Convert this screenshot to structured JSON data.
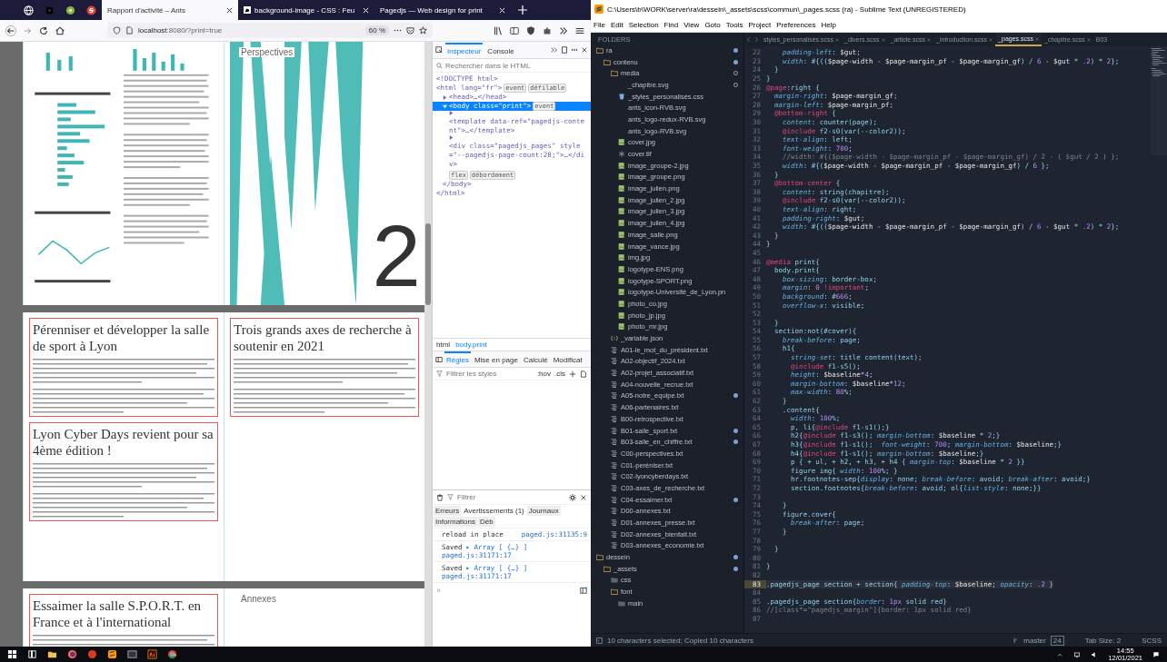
{
  "browser": {
    "tabs": [
      {
        "kind": "globe",
        "selected": false
      },
      {
        "kind": "dark",
        "selected": false
      },
      {
        "kind": "green",
        "selected": false
      },
      {
        "kind": "red",
        "selected": false
      },
      {
        "kind": "page",
        "title": "Rapport d'activité – Ants",
        "selected": true
      },
      {
        "kind": "mdn",
        "title": "background-image - CSS : Feu",
        "selected": false
      },
      {
        "kind": "page",
        "title": "Pagedjs — Web design for print",
        "selected": false
      }
    ],
    "url_host": "localhost",
    "url_rest": ":8080/?print=true",
    "zoom": "60 %",
    "document": {
      "spreads": [
        {
          "pages": [
            {
              "kind": "charts"
            },
            {
              "kind": "chapter",
              "label": "Perspectives",
              "number": "2"
            }
          ]
        },
        {
          "pages": [
            {
              "kind": "article",
              "headings": [
                "Pérenniser et développer la salle de sport à Lyon",
                "Lyon Cyber Days revient pour sa 4ème édition !"
              ]
            },
            {
              "kind": "article",
              "headings": [
                "Trois grands axes de recherche à soutenir en 2021"
              ]
            }
          ]
        },
        {
          "pages": [
            {
              "kind": "article",
              "headings": [
                "Essaimer la salle S.P.O.R.T. en France et à l'international"
              ]
            },
            {
              "kind": "label",
              "label": "Annexes"
            }
          ]
        }
      ]
    },
    "devtools": {
      "tabs": [
        {
          "label": "Inspecteur",
          "selected": true
        },
        {
          "label": "Console",
          "selected": false
        }
      ],
      "search_placeholder": "Rechercher dans le HTML",
      "tree": [
        {
          "text": "<!DOCTYPE html>",
          "selected": false
        },
        {
          "text": "<html lang=\"fr\">",
          "badges": [
            "event",
            "défilable"
          ],
          "selected": false,
          "children": [
            {
              "text": "<head>…</head>",
              "expanded": false,
              "selected": false
            },
            {
              "text": "<body class=\"print\">",
              "badges": [
                "event"
              ],
              "expanded": true,
              "selected": true,
              "children": [
                {
                  "text": "<template data-ref=\"pagedjs-content\">…</template>",
                  "expanded": false,
                  "selected": false
                },
                {
                  "text": "<div class=\"pagedjs_pages\" style=\"--pagedjs-page-count:28;\">…</div>",
                  "badges": [
                    "flex",
                    "débordement"
                  ],
                  "expanded": false,
                  "selected": false
                }
              ]
            },
            {
              "text": "</body>",
              "selected": false
            }
          ]
        },
        {
          "text": "</html>",
          "selected": false
        }
      ],
      "breadcrumb": [
        "html",
        "body.print"
      ],
      "rules_tabs": [
        {
          "label": "Règles",
          "selected": true
        },
        {
          "label": "Mise en page",
          "selected": false
        },
        {
          "label": "Calculé",
          "selected": false
        },
        {
          "label": "Modificat",
          "selected": false
        }
      ],
      "rules_filter_placeholder": "Filtrer les styles",
      "rules_buttons": [
        ":hov",
        ".cls"
      ],
      "console_filter_placeholder": "Filtrer",
      "console_tabs": [
        {
          "label": "Erreurs",
          "selected": false
        },
        {
          "label": "Avertissements (1)",
          "selected": true
        },
        {
          "label": "Journaux",
          "selected": false
        },
        {
          "label": "Informations",
          "selected": false
        },
        {
          "label": "Déb",
          "selected": false
        }
      ],
      "messages": [
        {
          "text": "reload in place",
          "source": "paged.js:31135:9"
        },
        {
          "text": "Saved",
          "object": "▸ Array [ {…} ]",
          "source": "paged.js:31171:17"
        },
        {
          "text": "Saved",
          "object": "▸ Array [ {…} ]",
          "source": "paged.js:31171:17"
        }
      ],
      "prompt": "»"
    }
  },
  "editor": {
    "title": "C:\\Users\\b\\WORK\\server\\ra\\dessein\\_assets\\scss\\commun\\_pages.scss (ra) - Sublime Text (UNREGISTERED)",
    "menu": [
      "File",
      "Edit",
      "Selection",
      "Find",
      "View",
      "Goto",
      "Tools",
      "Project",
      "Preferences",
      "Help"
    ],
    "sidebar_heading": "FOLDERS",
    "tree": [
      {
        "name": "ra",
        "kind": "folder",
        "expanded": true,
        "modified": true,
        "untracked": false,
        "children": [
          {
            "name": "contenu",
            "kind": "folder",
            "expanded": true,
            "modified": true,
            "untracked": false,
            "children": [
              {
                "name": "media",
                "kind": "folder",
                "expanded": true,
                "modified": false,
                "untracked": true,
                "children": [
                  {
                    "name": "_chapitre.svg",
                    "kind": "svg",
                    "modified": false,
                    "untracked": true
                  },
                  {
                    "name": "_styles_personalisés.css",
                    "kind": "css",
                    "modified": false,
                    "untracked": false
                  },
                  {
                    "name": "ants_icon-RVB.svg",
                    "kind": "svg",
                    "modified": false,
                    "untracked": false
                  },
                  {
                    "name": "ants_logo-redux-RVB.svg",
                    "kind": "svg",
                    "modified": false,
                    "untracked": false
                  },
                  {
                    "name": "ants_logo-RVB.svg",
                    "kind": "svg",
                    "modified": false,
                    "untracked": false
                  },
                  {
                    "name": "cover.jpg",
                    "kind": "image",
                    "modified": false,
                    "untracked": false
                  },
                  {
                    "name": "cover.tif",
                    "kind": "tif",
                    "modified": false,
                    "untracked": false
                  },
                  {
                    "name": "image_groupe-2.jpg",
                    "kind": "image",
                    "modified": false,
                    "untracked": false
                  },
                  {
                    "name": "image_groupe.png",
                    "kind": "image",
                    "modified": false,
                    "untracked": false
                  },
                  {
                    "name": "image_julien.png",
                    "kind": "image",
                    "modified": false,
                    "untracked": false
                  },
                  {
                    "name": "image_julien_2.jpg",
                    "kind": "image",
                    "modified": false,
                    "untracked": false
                  },
                  {
                    "name": "image_julien_3.jpg",
                    "kind": "image",
                    "modified": false,
                    "untracked": false
                  },
                  {
                    "name": "image_julien_4.jpg",
                    "kind": "image",
                    "modified": false,
                    "untracked": false
                  },
                  {
                    "name": "image_salle.png",
                    "kind": "image",
                    "modified": false,
                    "untracked": false
                  },
                  {
                    "name": "image_vance.jpg",
                    "kind": "image",
                    "modified": false,
                    "untracked": false
                  },
                  {
                    "name": "img.jpg",
                    "kind": "image",
                    "modified": false,
                    "untracked": false
                  },
                  {
                    "name": "logotype-ENS.png",
                    "kind": "image",
                    "modified": false,
                    "untracked": false
                  },
                  {
                    "name": "logotype-SPORT.png",
                    "kind": "image",
                    "modified": false,
                    "untracked": false
                  },
                  {
                    "name": "logotype-Université_de_Lyon.pn",
                    "kind": "image",
                    "modified": false,
                    "untracked": false
                  },
                  {
                    "name": "photo_co.jpg",
                    "kind": "image",
                    "modified": false,
                    "untracked": false
                  },
                  {
                    "name": "photo_jp.jpg",
                    "kind": "image",
                    "modified": false,
                    "untracked": false
                  },
                  {
                    "name": "photo_mr.jpg",
                    "kind": "image",
                    "modified": false,
                    "untracked": false
                  }
                ]
              },
              {
                "name": "_variable.json",
                "kind": "json",
                "modified": false,
                "untracked": false
              },
              {
                "name": "A01-le_mot_du_président.txt",
                "kind": "text",
                "modified": false,
                "untracked": false
              },
              {
                "name": "A02-objectif_2024.txt",
                "kind": "text",
                "modified": false,
                "untracked": false
              },
              {
                "name": "A02-projet_associatif.txt",
                "kind": "text",
                "modified": false,
                "untracked": false
              },
              {
                "name": "A04-nouvelle_recrue.txt",
                "kind": "text",
                "modified": false,
                "untracked": false
              },
              {
                "name": "A05-notre_equipe.txt",
                "kind": "text",
                "modified": true,
                "untracked": false
              },
              {
                "name": "A06-partenaires.txt",
                "kind": "text",
                "modified": false,
                "untracked": false
              },
              {
                "name": "B00-retrospective.txt",
                "kind": "text",
                "modified": false,
                "untracked": false
              },
              {
                "name": "B01-salle_sport.txt",
                "kind": "text",
                "modified": true,
                "untracked": false
              },
              {
                "name": "B03-salle_en_chiffre.txt",
                "kind": "text",
                "modified": true,
                "untracked": false
              },
              {
                "name": "C00-perspectives.txt",
                "kind": "text",
                "modified": false,
                "untracked": false
              },
              {
                "name": "C01-peréniser.txt",
                "kind": "text",
                "modified": false,
                "untracked": false
              },
              {
                "name": "C02-lyoncyberdays.txt",
                "kind": "text",
                "modified": false,
                "untracked": false
              },
              {
                "name": "C03-axes_de_recherche.txt",
                "kind": "text",
                "modified": false,
                "untracked": false
              },
              {
                "name": "C04-essaimer.txt",
                "kind": "text",
                "modified": true,
                "untracked": false
              },
              {
                "name": "D00-annexes.txt",
                "kind": "text",
                "modified": false,
                "untracked": false
              },
              {
                "name": "D01-annexes_presse.txt",
                "kind": "text",
                "modified": false,
                "untracked": false
              },
              {
                "name": "D02-annexes_bienfait.txt",
                "kind": "text",
                "modified": false,
                "untracked": false
              },
              {
                "name": "D03-annexes_economie.txt",
                "kind": "text",
                "modified": false,
                "untracked": false
              }
            ]
          }
        ]
      },
      {
        "name": "dessein",
        "kind": "folder",
        "expanded": true,
        "modified": true,
        "untracked": false,
        "children": [
          {
            "name": "_assets",
            "kind": "folder",
            "expanded": true,
            "modified": true,
            "untracked": false,
            "children": [
              {
                "name": "css",
                "kind": "folder",
                "expanded": false,
                "modified": false,
                "untracked": false
              },
              {
                "name": "font",
                "kind": "folder",
                "expanded": true,
                "modified": false,
                "untracked": false,
                "children": [
                  {
                    "name": "main",
                    "kind": "folder",
                    "expanded": false,
                    "modified": false,
                    "untracked": false
                  }
                ]
              }
            ]
          }
        ]
      }
    ],
    "tabs": [
      {
        "label": "styles_personalisés.scss",
        "selected": false
      },
      {
        "label": "_divers.scss",
        "selected": false
      },
      {
        "label": "_article.scss",
        "selected": false
      },
      {
        "label": "_introduction.scss",
        "selected": false
      },
      {
        "label": "_pages.scss",
        "selected": true
      },
      {
        "label": "_chapitre.scss",
        "selected": false
      },
      {
        "label": "B03",
        "selected": false
      }
    ],
    "lines": [
      {
        "n": "22",
        "text": "    padding-left: $gut;"
      },
      {
        "n": "23",
        "text": "    width: #{(($page-width - $page-margin_pf - $page-margin_gf) / 6 - $gut * .2) * 2};"
      },
      {
        "n": "24",
        "text": "  }"
      },
      {
        "n": "25",
        "text": "}"
      },
      {
        "n": "26",
        "text": "@page:right {"
      },
      {
        "n": "27",
        "text": "  margin-right: $page-margin_gf;"
      },
      {
        "n": "28",
        "text": "  margin-left: $page-margin_pf;"
      },
      {
        "n": "29",
        "text": "  @bottom-right {"
      },
      {
        "n": "30",
        "text": "    content: counter(page);"
      },
      {
        "n": "31",
        "text": "    @include f2-s0(var(--color2));"
      },
      {
        "n": "32",
        "text": "    text-align: left;"
      },
      {
        "n": "33",
        "text": "    font-weight: 700;"
      },
      {
        "n": "34",
        "text": "    //width: #{($page-width - $page-margin_pf - $page-margin_gf) / 2 - ( $gut / 2 ) };"
      },
      {
        "n": "35",
        "text": "    width: #{($page-width - $page-margin_pf - $page-margin_gf) / 6 };"
      },
      {
        "n": "36",
        "text": "  }"
      },
      {
        "n": "37",
        "text": "  @bottom-center {"
      },
      {
        "n": "38",
        "text": "    content: string(chapitre);"
      },
      {
        "n": "39",
        "text": "    @include f2-s0(var(--color2));"
      },
      {
        "n": "40",
        "text": "    text-align: right;"
      },
      {
        "n": "41",
        "text": "    padding-right: $gut;"
      },
      {
        "n": "42",
        "text": "    width: #{(($page-width - $page-margin_pf - $page-margin_gf) / 6 - $gut * .2) * 2};"
      },
      {
        "n": "43",
        "text": "  }"
      },
      {
        "n": "44",
        "text": "}"
      },
      {
        "n": "45"
      },
      {
        "n": "46",
        "text": "@media print{"
      },
      {
        "n": "47",
        "text": "  body.print{"
      },
      {
        "n": "48",
        "text": "    box-sizing: border-box;"
      },
      {
        "n": "49",
        "text": "    margin: 0 !important;"
      },
      {
        "n": "50",
        "text": "    background: #666;"
      },
      {
        "n": "51",
        "text": "    overflow-x: visible;"
      },
      {
        "n": "52"
      },
      {
        "n": "53",
        "text": "  }"
      },
      {
        "n": "54",
        "text": "  section:not(#cover){"
      },
      {
        "n": "55",
        "text": "    break-before: page;"
      },
      {
        "n": "56",
        "text": "    h1{"
      },
      {
        "n": "57",
        "text": "      string-set: title content(text);"
      },
      {
        "n": "58",
        "text": "      @include f1-s5();"
      },
      {
        "n": "59",
        "text": "      height: $baseline*4;"
      },
      {
        "n": "60",
        "text": "      margin-bottom: $baseline*12;"
      },
      {
        "n": "61",
        "text": "      max-width: 80%;"
      },
      {
        "n": "62",
        "text": "    }"
      },
      {
        "n": "63",
        "text": "    .content{"
      },
      {
        "n": "64",
        "text": "      width: 100%;"
      },
      {
        "n": "65",
        "text": "      p, li{@include f1-s1();}"
      },
      {
        "n": "66",
        "text": "      h2{@include f1-s3(); margin-bottom: $baseline * 2;}"
      },
      {
        "n": "67",
        "text": "      h3{@include f1-s1();  font-weight: 700; margin-bottom: $baseline;}"
      },
      {
        "n": "68",
        "text": "      h4{@include f1-s1(); margin-bottom: $baseline;}"
      },
      {
        "n": "69",
        "text": "      p { + ul, + h2, + h3, + h4 { margin-top: $baseline * 2 }}"
      },
      {
        "n": "70",
        "text": "      figure img{ width: 100%; }"
      },
      {
        "n": "71",
        "text": "      hr.footnotes-sep{display: none; break-before: avoid; break-after: avoid;}"
      },
      {
        "n": "72",
        "text": "      section.footnotes{break-before: avoid; ol{list-style: none;}}"
      },
      {
        "n": "73"
      },
      {
        "n": "74",
        "text": "    }"
      },
      {
        "n": "75",
        "text": "    figure.cover{"
      },
      {
        "n": "76",
        "text": "      break-after: page;"
      },
      {
        "n": "77",
        "text": "    }"
      },
      {
        "n": "78"
      },
      {
        "n": "79",
        "text": "  }"
      },
      {
        "n": "80"
      },
      {
        "n": "81",
        "text": "}"
      },
      {
        "n": "82"
      },
      {
        "n": "83",
        "current": true,
        "text": ".pagedjs_page section + section{ padding-top: $baseline; opacity: .2 }"
      },
      {
        "n": "84"
      },
      {
        "n": "85",
        "text": ".pagedjs_page section{border: 1px solid red}"
      },
      {
        "n": "86",
        "text": "//[class*=\"pagedjs_margin\"]{border: 1px solid red}"
      },
      {
        "n": "87"
      }
    ],
    "status": {
      "message": "10 characters selected; Copied 10 characters",
      "branch": "master",
      "changes": "24",
      "tab_size": "Tab Size: 2",
      "syntax": "SCSS"
    }
  },
  "taskbar": {
    "time": "14:55",
    "date": "12/01/2021"
  }
}
